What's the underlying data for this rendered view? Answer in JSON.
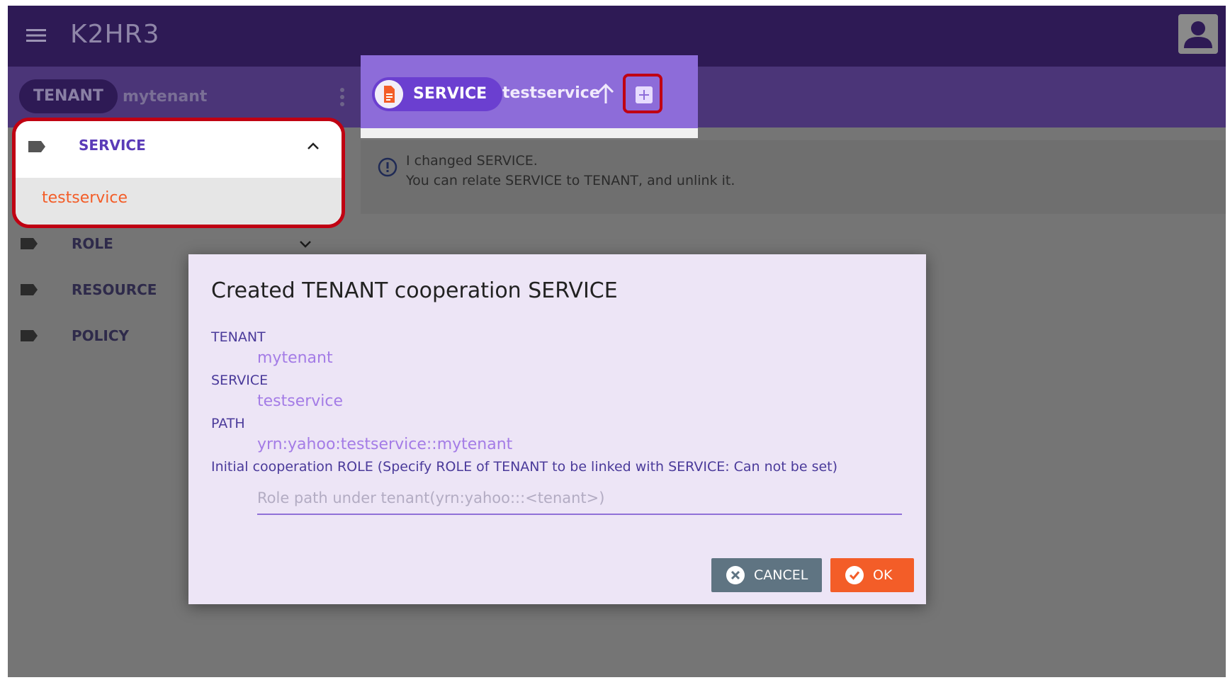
{
  "app": {
    "title": "K2HR3"
  },
  "header": {
    "tenant_chip": "TENANT",
    "tenant_name": "mytenant",
    "service_chip": "SERVICE",
    "service_name": "testservice"
  },
  "info": {
    "line1": "I changed SERVICE.",
    "line2": "You can relate SERVICE to TENANT, and unlink it."
  },
  "sidebar": {
    "items": [
      {
        "label": "SERVICE",
        "expanded": true,
        "children": [
          "testservice"
        ]
      },
      {
        "label": "ROLE",
        "expanded": false
      },
      {
        "label": "RESOURCE"
      },
      {
        "label": "POLICY"
      }
    ]
  },
  "dialog": {
    "title": "Created TENANT cooperation SERVICE",
    "tenant_label": "TENANT",
    "tenant_value": "mytenant",
    "service_label": "SERVICE",
    "service_value": "testservice",
    "path_label": "PATH",
    "path_value": "yrn:yahoo:testservice::mytenant",
    "role_label": "Initial cooperation ROLE (Specify ROLE of TENANT to be linked with SERVICE: Can not be set)",
    "role_placeholder": "Role path under tenant(yrn:yahoo:::<tenant>)",
    "role_value": "",
    "cancel_label": "CANCEL",
    "ok_label": "OK"
  },
  "colors": {
    "appbar": "#2e1a55",
    "accent": "#6b3fd0",
    "highlight": "#c00012",
    "ok": "#f35d28",
    "cancel": "#5f7482",
    "link": "#a47ce6"
  }
}
